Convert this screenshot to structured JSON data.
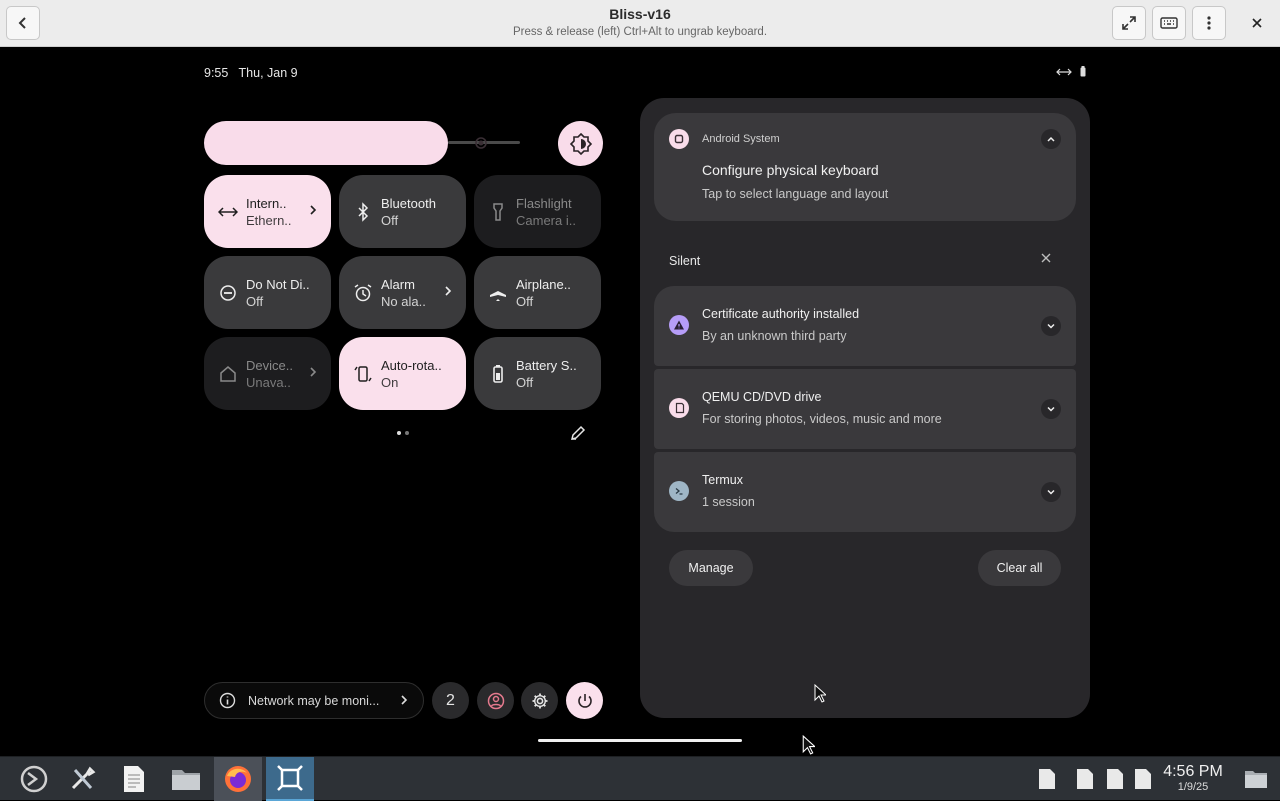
{
  "window": {
    "title": "Bliss-v16",
    "subtitle": "Press & release (left) Ctrl+Alt to ungrab keyboard."
  },
  "status_bar": {
    "time": "9:55",
    "date": "Thu, Jan 9"
  },
  "quick_settings": {
    "tiles": [
      {
        "id": "internet",
        "label": "Intern..",
        "sub": "Ethern..",
        "state": "on",
        "chevron": true,
        "icon": "ethernet-icon"
      },
      {
        "id": "bluetooth",
        "label": "Bluetooth",
        "sub": "Off",
        "state": "off",
        "chevron": false,
        "icon": "bluetooth-icon"
      },
      {
        "id": "flashlight",
        "label": "Flashlight",
        "sub": "Camera i..",
        "state": "unavailable",
        "chevron": false,
        "icon": "flashlight-icon"
      },
      {
        "id": "dnd",
        "label": "Do Not Di..",
        "sub": "Off",
        "state": "off",
        "chevron": false,
        "icon": "do-not-disturb-icon"
      },
      {
        "id": "alarm",
        "label": "Alarm",
        "sub": "No ala..",
        "state": "off",
        "chevron": true,
        "icon": "alarm-icon"
      },
      {
        "id": "airplane",
        "label": "Airplane..",
        "sub": "Off",
        "state": "off",
        "chevron": false,
        "icon": "airplane-icon"
      },
      {
        "id": "device",
        "label": "Device..",
        "sub": "Unava..",
        "state": "unavailable",
        "chevron": true,
        "icon": "home-icon"
      },
      {
        "id": "autorotate",
        "label": "Auto-rota..",
        "sub": "On",
        "state": "on",
        "chevron": false,
        "icon": "auto-rotate-icon"
      },
      {
        "id": "battery",
        "label": "Battery S..",
        "sub": "Off",
        "state": "off",
        "chevron": false,
        "icon": "battery-saver-icon"
      }
    ],
    "footer": {
      "network_warning": "Network may be moni...",
      "user_count": "2"
    }
  },
  "notifications": {
    "top": {
      "app": "Android System",
      "title": "Configure physical keyboard",
      "text": "Tap to select language and layout"
    },
    "section_label": "Silent",
    "items": [
      {
        "title": "Certificate authority installed",
        "text": "By an unknown third party",
        "icon": "warning-icon",
        "icon_bg": "#b69df8"
      },
      {
        "title": "QEMU CD/DVD drive",
        "text": "For storing photos, videos, music and more",
        "icon": "sd-card-icon",
        "icon_bg": "#f9dcea"
      },
      {
        "title": "Termux",
        "text": "1 session",
        "icon": "terminal-icon",
        "icon_bg": "#9fb6c6"
      }
    ],
    "manage_label": "Manage",
    "clear_label": "Clear all"
  },
  "taskbar": {
    "time": "4:56 PM",
    "date": "1/9/25"
  },
  "colors": {
    "accent_pink": "#fae0ec",
    "tile_off": "#3a3a3c",
    "panel": "#28272a"
  }
}
